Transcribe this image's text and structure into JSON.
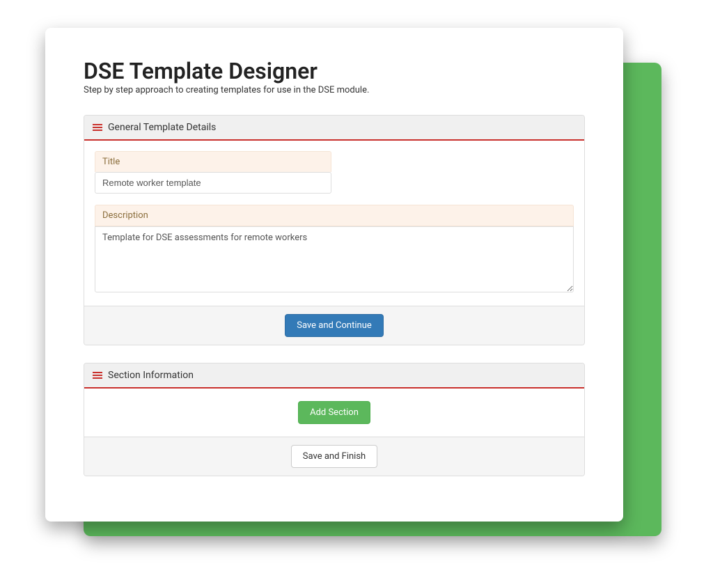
{
  "header": {
    "title": "DSE Template Designer",
    "subtitle": "Step by step approach to creating templates for use in the DSE module."
  },
  "panel_general": {
    "title": "General Template Details",
    "title_label": "Title",
    "title_value": "Remote worker template",
    "description_label": "Description",
    "description_value": "Template for DSE assessments for remote workers",
    "save_continue_label": "Save and Continue"
  },
  "panel_section": {
    "title": "Section Information",
    "add_section_label": "Add Section",
    "save_finish_label": "Save and Finish"
  }
}
